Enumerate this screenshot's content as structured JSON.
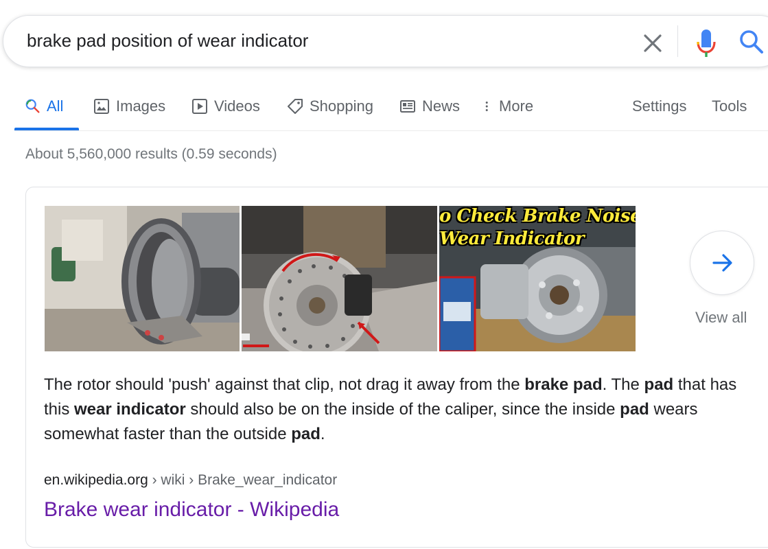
{
  "search": {
    "query": "brake pad position of wear indicator",
    "clear_icon": "close-icon",
    "mic_icon": "microphone-icon",
    "search_icon": "search-icon"
  },
  "tabs": [
    {
      "label": "All",
      "icon": "search-icon",
      "active": true
    },
    {
      "label": "Images",
      "icon": "image-icon"
    },
    {
      "label": "Videos",
      "icon": "play-icon"
    },
    {
      "label": "Shopping",
      "icon": "tag-icon"
    },
    {
      "label": "News",
      "icon": "newspaper-icon"
    },
    {
      "label": "More",
      "icon": "more-vert-icon"
    }
  ],
  "settings_label": "Settings",
  "tools_label": "Tools",
  "stats": "About 5,560,000 results (0.59 seconds)",
  "featured": {
    "thumbnail_overlay": [
      "o Check Brake Noise",
      "Wear Indicator"
    ],
    "view_all": "View all",
    "snippet": [
      {
        "text": "The rotor should 'push' against that clip, not drag it away from the ",
        "bold": false
      },
      {
        "text": "brake pad",
        "bold": true
      },
      {
        "text": ". The ",
        "bold": false
      },
      {
        "text": "pad",
        "bold": true
      },
      {
        "text": " that has this ",
        "bold": false
      },
      {
        "text": "wear indicator",
        "bold": true
      },
      {
        "text": " should also be on the inside of the caliper, since the inside ",
        "bold": false
      },
      {
        "text": "pad",
        "bold": true
      },
      {
        "text": " wears somewhat faster than the outside ",
        "bold": false
      },
      {
        "text": "pad",
        "bold": true
      },
      {
        "text": ".",
        "bold": false
      }
    ],
    "cite_domain": "en.wikipedia.org",
    "cite_path": " › wiki › Brake_wear_indicator",
    "title": "Brake wear indicator - Wikipedia"
  },
  "colors": {
    "accent": "#1a73e8",
    "visited_link": "#681da8",
    "muted": "#70757a"
  }
}
